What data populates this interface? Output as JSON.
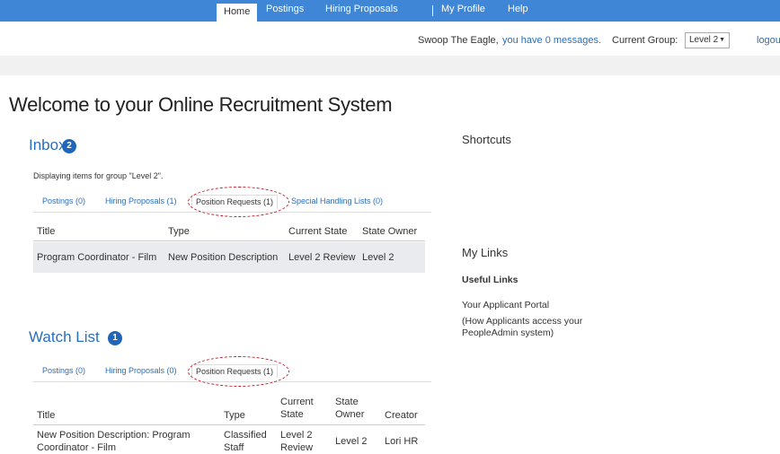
{
  "nav": {
    "home": "Home",
    "postings": "Postings",
    "hiring_proposals": "Hiring Proposals",
    "my_profile": "My Profile",
    "help": "Help"
  },
  "userbar": {
    "user": "Swoop The Eagle,",
    "messages_link": "you have 0 messages.",
    "current_group_label": "Current Group:",
    "current_group_value": "Level 2",
    "logout": "logou"
  },
  "page_title": "Welcome to your Online Recruitment System",
  "inbox": {
    "title": "Inbox",
    "badge": "2",
    "group_note": "Displaying items for group \"Level 2\".",
    "tabs": [
      "Postings (0)",
      "Hiring Proposals (1)",
      "Position Requests (1)",
      "Special Handling Lists (0)"
    ],
    "columns": [
      "Title",
      "Type",
      "Current State",
      "State Owner"
    ],
    "rows": [
      {
        "title": "Program Coordinator - Film",
        "type": "New Position Description",
        "state": "Level 2 Review",
        "owner": "Level 2"
      }
    ]
  },
  "watch_list": {
    "title": "Watch List",
    "badge": "1",
    "tabs": [
      "Postings (0)",
      "Hiring Proposals (0)",
      "Position Requests (1)"
    ],
    "columns": {
      "title": "Title",
      "type": "Type",
      "state_1": "Current",
      "state_2": "State",
      "owner_1": "State",
      "owner_2": "Owner",
      "creator": "Creator"
    },
    "rows": [
      {
        "title_1": "New Position Description: Program",
        "title_2": "Coordinator - Film",
        "type_1": "Classified",
        "type_2": "Staff",
        "state_1": "Level 2",
        "state_2": "Review",
        "owner": "Level 2",
        "creator": "Lori HR"
      }
    ]
  },
  "shortcuts": {
    "title": "Shortcuts"
  },
  "my_links": {
    "title": "My Links",
    "useful_links": "Useful Links",
    "applicant_portal": "Your Applicant Portal",
    "portal_desc_1": "(How Applicants access your",
    "portal_desc_2": "PeopleAdmin system)"
  },
  "colors": {
    "nav_bg": "#3f87d6",
    "link": "#2a6ebb",
    "badge": "#1f66b8",
    "highlight_oval": "#c0202b"
  }
}
